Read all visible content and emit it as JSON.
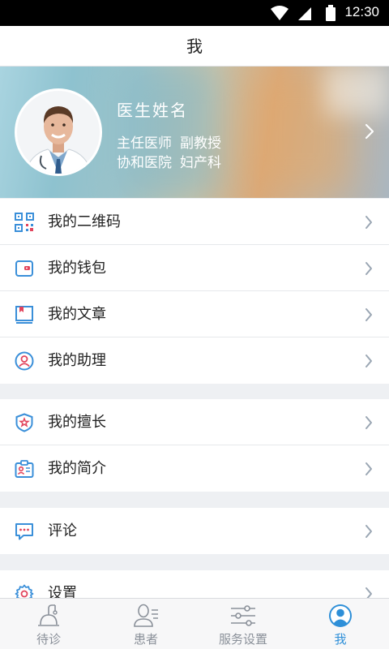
{
  "status_bar": {
    "time": "12:30"
  },
  "header": {
    "title": "我"
  },
  "profile": {
    "name": "医生姓名",
    "title": "主任医师",
    "academic_title": "副教授",
    "hospital": "协和医院",
    "department": "妇产科"
  },
  "menu": {
    "group1": [
      {
        "label": "我的二维码",
        "icon": "qrcode-icon"
      },
      {
        "label": "我的钱包",
        "icon": "wallet-icon"
      },
      {
        "label": "我的文章",
        "icon": "article-book-icon"
      },
      {
        "label": "我的助理",
        "icon": "assistant-icon"
      }
    ],
    "group2": [
      {
        "label": "我的擅长",
        "icon": "expertise-star-icon"
      },
      {
        "label": "我的简介",
        "icon": "profile-card-icon"
      }
    ],
    "group3": [
      {
        "label": "评论",
        "icon": "comment-bubble-icon"
      }
    ],
    "group4": [
      {
        "label": "设置",
        "icon": "settings-gear-icon"
      }
    ]
  },
  "tabs": [
    {
      "label": "待诊",
      "icon": "consultation-icon",
      "active": false
    },
    {
      "label": "患者",
      "icon": "patients-icon",
      "active": false
    },
    {
      "label": "服务设置",
      "icon": "service-settings-icon",
      "active": false
    },
    {
      "label": "我",
      "icon": "me-person-icon",
      "active": true
    }
  ],
  "colors": {
    "accent": "#2e8fd8",
    "icon_blue": "#3a8fd9",
    "icon_red": "#e2445c",
    "chevron": "#9aa6b3",
    "separator_bg": "#eef0f3"
  }
}
